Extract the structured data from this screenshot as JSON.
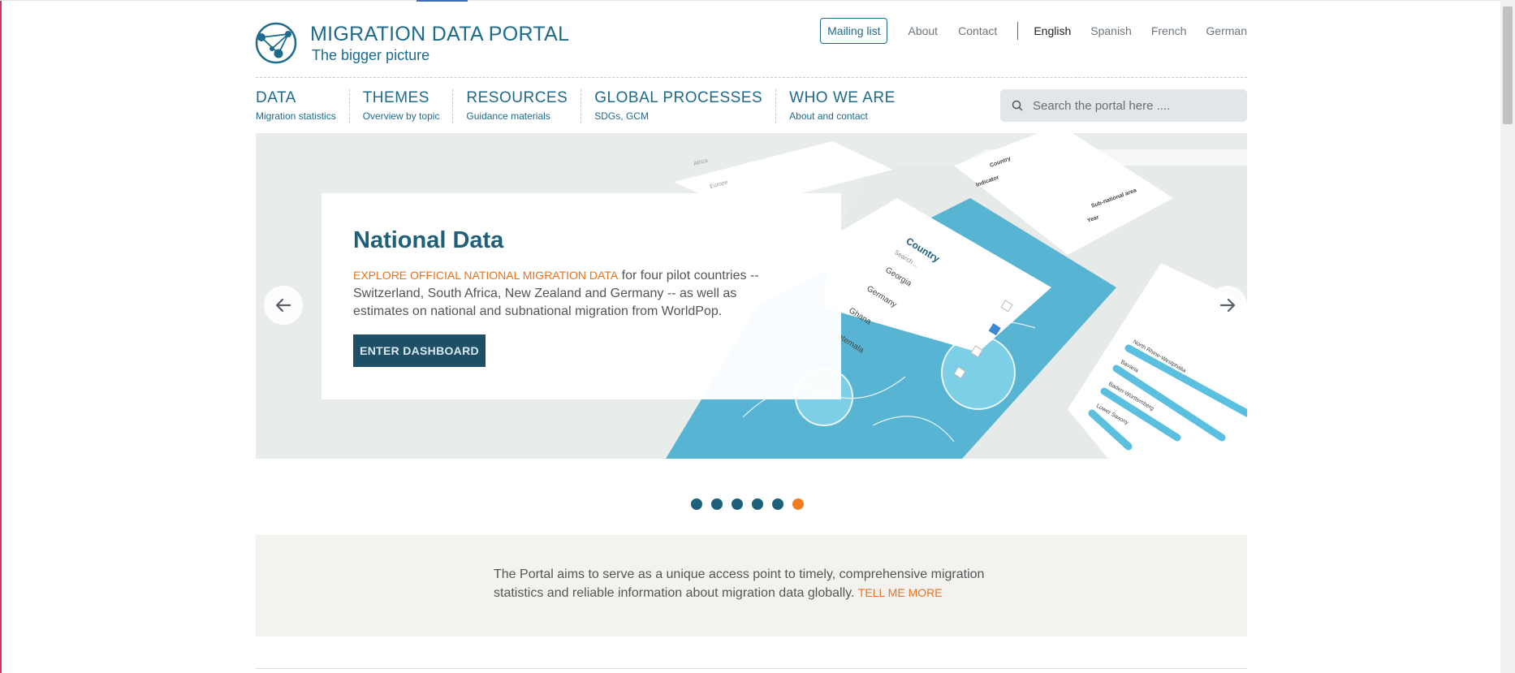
{
  "header": {
    "title": "MIGRATION DATA PORTAL",
    "tagline": "The bigger picture"
  },
  "topnav": {
    "mailing_list": "Mailing list",
    "about": "About",
    "contact": "Contact",
    "languages": [
      "English",
      "Spanish",
      "French",
      "German"
    ],
    "active_language": "English"
  },
  "mainnav": [
    {
      "title": "DATA",
      "subtitle": "Migration statistics"
    },
    {
      "title": "THEMES",
      "subtitle": "Overview by topic"
    },
    {
      "title": "RESOURCES",
      "subtitle": "Guidance materials"
    },
    {
      "title": "GLOBAL PROCESSES",
      "subtitle": "SDGs, GCM"
    },
    {
      "title": "WHO WE ARE",
      "subtitle": "About and contact"
    }
  ],
  "search": {
    "placeholder": "Search the portal here ...."
  },
  "hero": {
    "title": "National Data",
    "highlight": "EXPLORE OFFICIAL NATIONAL MIGRATION DATA",
    "text": " for four pilot countries -- Switzerland, South Africa, New Zealand and Germany -- as well as estimates on national and subnational migration from WorldPop.",
    "button": "ENTER DASHBOARD",
    "illustration": {
      "panel_title": "Country",
      "panel_search": "Search ...",
      "countries": [
        "Georgia",
        "Germany",
        "Ghana",
        "Guatemala"
      ],
      "filters": [
        "Country",
        "Indicator",
        "Sub-national area",
        "Year"
      ],
      "regions": [
        "North Rhine-Westphalia",
        "Bavaria",
        "Baden-Württemberg",
        "Lower Saxony"
      ]
    },
    "colors": {
      "accent": "#e8731c",
      "primary": "#1e5f7a",
      "map": "#5ab6d3"
    }
  },
  "carousel": {
    "slides": 6,
    "active_index": 6
  },
  "about": {
    "text": "The Portal aims to serve as a unique access point to timely, comprehensive migration statistics and reliable information about migration data globally.",
    "link": "TELL ME MORE"
  }
}
